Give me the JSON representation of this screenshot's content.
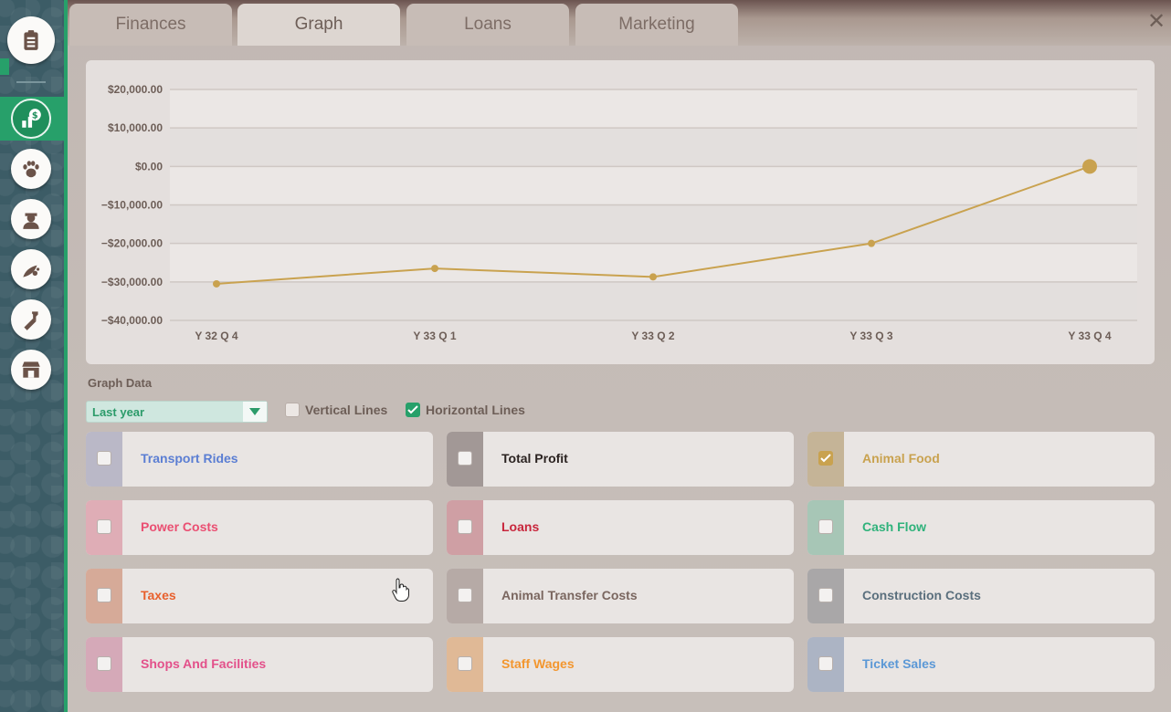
{
  "tabs": [
    "Finances",
    "Graph",
    "Loans",
    "Marketing"
  ],
  "active_tab": "Graph",
  "sidebar": {
    "icons": [
      "clipboard-icon",
      "finance-icon",
      "paw-icon",
      "staff-icon",
      "animal-care-icon",
      "research-icon",
      "shop-icon"
    ],
    "active": "finance-icon"
  },
  "close_label": "✕",
  "chart_data": {
    "type": "line",
    "categories": [
      "Y 32 Q 4",
      "Y 33 Q 1",
      "Y 33 Q 2",
      "Y 33 Q 3",
      "Y 33 Q 4"
    ],
    "series": [
      {
        "name": "Animal Food",
        "color": "#c9a24f",
        "values": [
          -30500,
          -26500,
          -28700,
          -20000,
          0
        ]
      }
    ],
    "yticks": [
      20000,
      10000,
      0,
      -10000,
      -20000,
      -30000,
      -40000
    ],
    "ytick_labels": [
      "$20,000.00",
      "$10,000.00",
      "$0.00",
      "−$10,000.00",
      "−$20,000.00",
      "−$30,000.00",
      "−$40,000.00"
    ],
    "ylim": [
      -40000,
      20000
    ],
    "horizontal_grid": true,
    "vertical_grid": false,
    "highlight_last_point": true
  },
  "graph_data_label": "Graph Data",
  "range_select": {
    "value": "Last year"
  },
  "toggles": [
    {
      "label": "Vertical Lines",
      "checked": false
    },
    {
      "label": "Horizontal Lines",
      "checked": true
    }
  ],
  "series_cards": [
    {
      "label": "Transport Rides",
      "checked": false,
      "color": "#5b7ed3",
      "swatch": "#bab8c7"
    },
    {
      "label": "Total Profit",
      "checked": false,
      "color": "#2b2321",
      "swatch": "#a29896"
    },
    {
      "label": "Animal Food",
      "checked": true,
      "color": "#c9a24f",
      "swatch": "#c5b497"
    },
    {
      "label": "Power Costs",
      "checked": false,
      "color": "#ea4f72",
      "swatch": "#dfadb6"
    },
    {
      "label": "Loans",
      "checked": false,
      "color": "#c8263c",
      "swatch": "#cf9fa4"
    },
    {
      "label": "Cash Flow",
      "checked": false,
      "color": "#2fb27b",
      "swatch": "#a7c6b6"
    },
    {
      "label": "Taxes",
      "checked": false,
      "color": "#e8602d",
      "swatch": "#d6aa98"
    },
    {
      "label": "Animal Transfer Costs",
      "checked": false,
      "color": "#7a665f",
      "swatch": "#b6aaa6"
    },
    {
      "label": "Construction Costs",
      "checked": false,
      "color": "#5a6f7d",
      "swatch": "#a9a7a8"
    },
    {
      "label": "Shops And Facilities",
      "checked": false,
      "color": "#e3508a",
      "swatch": "#d5a9b8"
    },
    {
      "label": "Staff Wages",
      "checked": false,
      "color": "#f3962e",
      "swatch": "#e0b996"
    },
    {
      "label": "Ticket Sales",
      "checked": false,
      "color": "#5b98d6",
      "swatch": "#acb4c4"
    }
  ]
}
